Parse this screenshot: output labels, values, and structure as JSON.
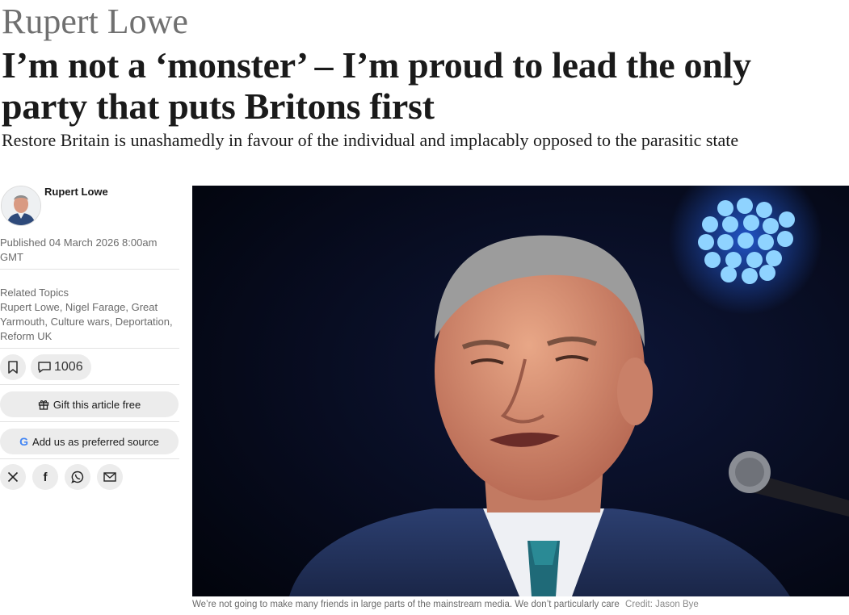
{
  "article": {
    "kicker": "Rupert Lowe",
    "headline": "I’m not a ‘monster’ – I’m proud to lead the only party that puts Britons first",
    "standfirst": "Restore Britain is unashamedly in favour of the individual and implacably opposed to the parasitic state"
  },
  "sidebar": {
    "author": "Rupert Lowe",
    "published": "Published 04 March 2026 8:00am GMT",
    "related_title": "Related Topics",
    "topics": "Rupert Lowe, Nigel Farage, Great Yarmouth, Culture wars, Deportation, Reform UK",
    "comment_count": "1006",
    "gift_label": "Gift this article free",
    "preferred_label": "Add us as preferred source",
    "share_icons": [
      "x-icon",
      "facebook-icon",
      "whatsapp-icon",
      "email-icon"
    ]
  },
  "photo": {
    "caption": "We’re not going to make many friends in large parts of the mainstream media. We don’t particularly care",
    "credit": "Credit: Jason Bye"
  },
  "colors": {
    "text": "#1a1a1a",
    "kicker": "#707070",
    "meta": "#6b6b6b",
    "pill": "#ececec",
    "stage_light": "#3da0ff"
  }
}
